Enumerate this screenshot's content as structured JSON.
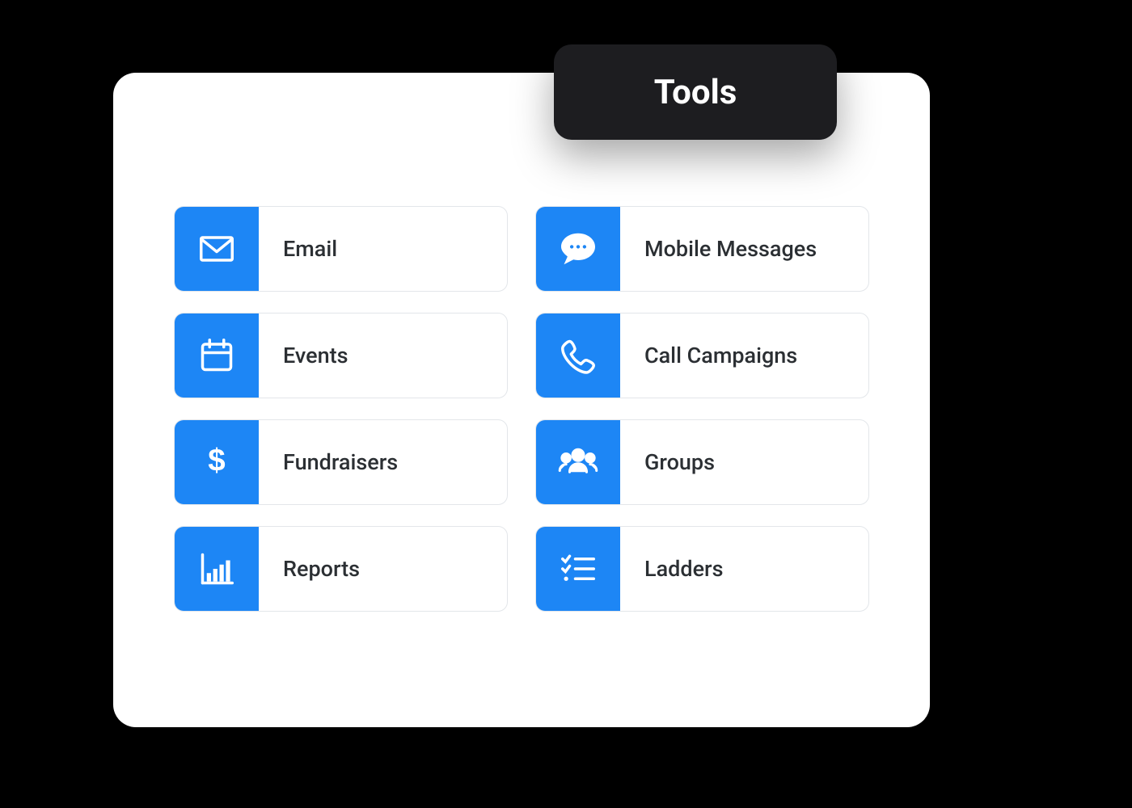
{
  "badge": {
    "label": "Tools"
  },
  "colors": {
    "accent": "#1d86f5",
    "badge_bg": "#1d1d20",
    "text": "#2b2f33"
  },
  "tools": [
    {
      "id": "email",
      "label": "Email",
      "icon": "envelope-icon"
    },
    {
      "id": "mobile-messages",
      "label": "Mobile Messages",
      "icon": "speech-bubble-icon"
    },
    {
      "id": "events",
      "label": "Events",
      "icon": "calendar-icon"
    },
    {
      "id": "call-campaigns",
      "label": "Call Campaigns",
      "icon": "phone-icon"
    },
    {
      "id": "fundraisers",
      "label": "Fundraisers",
      "icon": "dollar-icon"
    },
    {
      "id": "groups",
      "label": "Groups",
      "icon": "group-icon"
    },
    {
      "id": "reports",
      "label": "Reports",
      "icon": "bar-chart-icon"
    },
    {
      "id": "ladders",
      "label": "Ladders",
      "icon": "checklist-icon"
    }
  ]
}
